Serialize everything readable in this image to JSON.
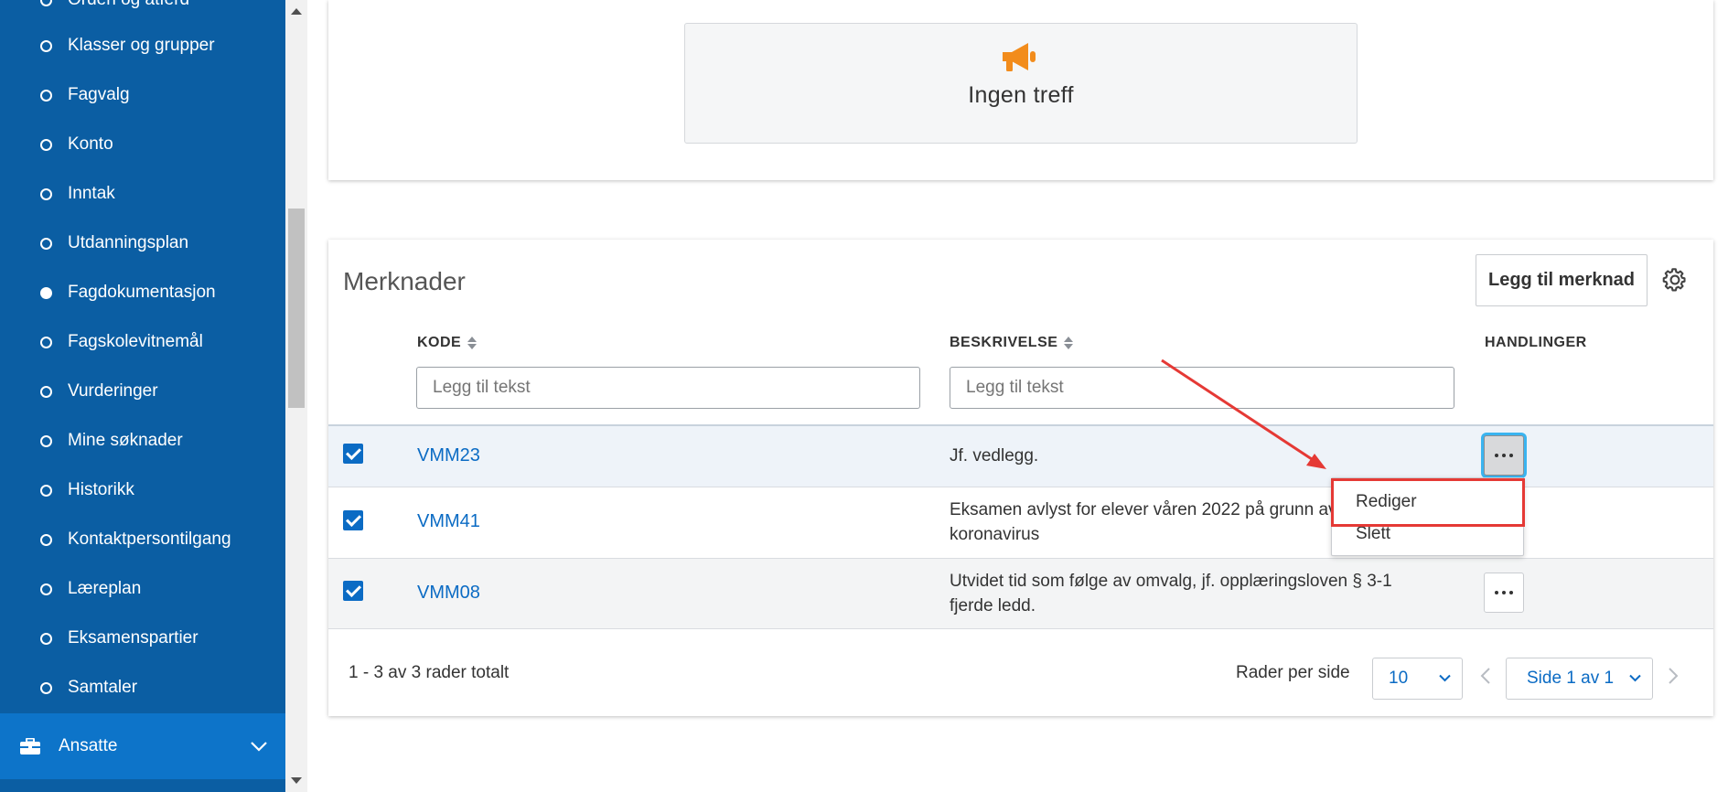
{
  "sidebar": {
    "items": [
      {
        "label": "Orden og atferd",
        "active": false
      },
      {
        "label": "Klasser og grupper",
        "active": false
      },
      {
        "label": "Fagvalg",
        "active": false
      },
      {
        "label": "Konto",
        "active": false
      },
      {
        "label": "Inntak",
        "active": false
      },
      {
        "label": "Utdanningsplan",
        "active": false
      },
      {
        "label": "Fagdokumentasjon",
        "active": true
      },
      {
        "label": "Fagskolevitnemål",
        "active": false
      },
      {
        "label": "Vurderinger",
        "active": false
      },
      {
        "label": "Mine søknader",
        "active": false
      },
      {
        "label": "Historikk",
        "active": false
      },
      {
        "label": "Kontaktpersontilgang",
        "active": false
      },
      {
        "label": "Læreplan",
        "active": false
      },
      {
        "label": "Eksamenspartier",
        "active": false
      },
      {
        "label": "Samtaler",
        "active": false
      }
    ],
    "section": {
      "label": "Ansatte",
      "icon": "briefcase-icon",
      "expand_icon": "chevron-down-icon"
    }
  },
  "empty_state": {
    "icon": "megaphone-icon",
    "text": "Ingen treff"
  },
  "merknader": {
    "title": "Merknader",
    "add_button": "Legg til merknad",
    "settings_icon": "gear-icon",
    "columns": {
      "kode": "KODE",
      "beskrivelse": "BESKRIVELSE",
      "handlinger": "HANDLINGER"
    },
    "filters": {
      "kode_placeholder": "Legg til tekst",
      "beskrivelse_placeholder": "Legg til tekst"
    },
    "rows": [
      {
        "checked": true,
        "kode": "VMM23",
        "desc1": "Jf. vedlegg.",
        "desc2": ""
      },
      {
        "checked": true,
        "kode": "VMM41",
        "desc1": "Eksamen avlyst for elever våren 2022 på grunn av",
        "desc2": "koronavirus"
      },
      {
        "checked": true,
        "kode": "VMM08",
        "desc1": "Utvidet tid som følge av omvalg, jf. opplæringsloven § 3-1",
        "desc2": "fjerde ledd."
      }
    ],
    "action_menu": {
      "items": [
        "Rediger",
        "Slett"
      ],
      "highlighted": "Rediger"
    },
    "footer": {
      "total": "1 - 3 av 3 rader totalt",
      "rows_per_page_label": "Rader per side",
      "rows_per_page_value": "10",
      "page_value": "Side 1 av 1"
    }
  },
  "colors": {
    "sidebar": "#0b5ea3",
    "sidebar_section": "#0d74c9",
    "accent": "#0b6bc4",
    "megaphone": "#f28c1c",
    "annotation": "#e53935"
  }
}
